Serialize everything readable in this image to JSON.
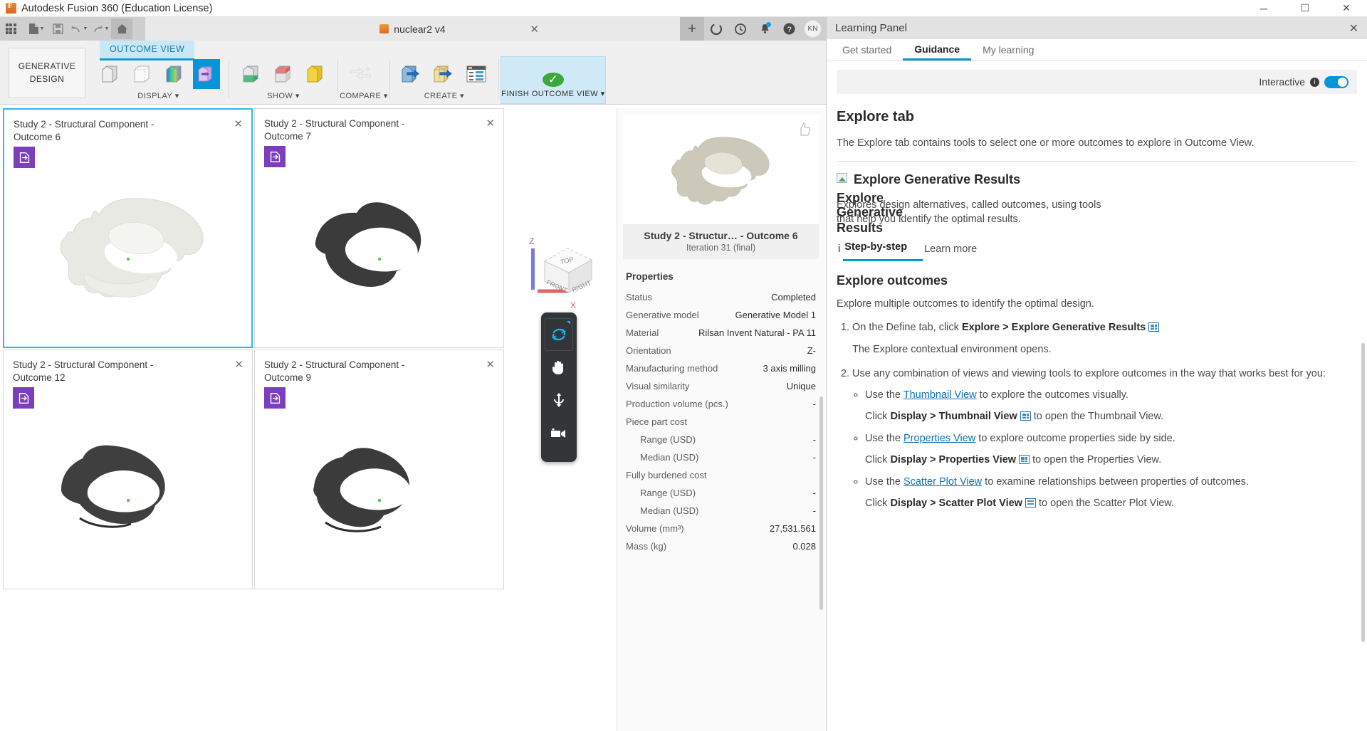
{
  "titlebar": {
    "app_title": "Autodesk Fusion 360 (Education License)",
    "minimize": "─",
    "maximize": "☐",
    "close": "✕"
  },
  "quick_access": {
    "grid_icon": "grid-apps-icon",
    "new_label": "new-document",
    "save_label": "save",
    "undo_label": "undo",
    "redo_label": "redo",
    "home_label": "home",
    "document_tab": "nuclear2 v4",
    "document_close": "✕",
    "add_tab": "+",
    "icons": [
      "job-status-icon",
      "recent-icon",
      "notifications-icon",
      "help-icon"
    ],
    "avatar_initials": "KN"
  },
  "ribbon": {
    "workspace_tab": "OUTCOME VIEW",
    "workspace_button": {
      "line1": "GENERATIVE",
      "line2": "DESIGN"
    },
    "groups": [
      {
        "label": "DISPLAY ▾",
        "items": [
          "shaded-box-icon",
          "wireframe-box-icon",
          "heatmap-box-icon",
          "outcome-view-icon"
        ]
      },
      {
        "label": "SHOW ▾",
        "items": [
          "green-white-box-icon",
          "red-white-box-icon",
          "yellow-box-icon"
        ]
      },
      {
        "label": "COMPARE ▾",
        "items": [
          "compare-arrows-icon"
        ]
      },
      {
        "label": "CREATE ▾",
        "items": [
          "blue-cube-arrow-icon",
          "mesh-cube-arrow-icon",
          "table-list-icon"
        ]
      }
    ],
    "finish": {
      "label": "FINISH OUTCOME VIEW ▾",
      "icon": "green-check-icon"
    }
  },
  "outcomes": [
    {
      "title": "Study 2 - Structural Component - Outcome 6",
      "selected": true,
      "close": "✕",
      "badge": "export-icon",
      "shade": "light"
    },
    {
      "title": "Study 2 - Structural Component - Outcome 7",
      "selected": false,
      "close": "✕",
      "badge": "export-icon",
      "shade": "dark"
    },
    {
      "title": "Study 2 - Structural Component - Outcome 12",
      "selected": false,
      "close": "✕",
      "badge": "export-icon",
      "shade": "dark"
    },
    {
      "title": "Study 2 - Structural Component - Outcome 9",
      "selected": false,
      "close": "✕",
      "badge": "export-icon",
      "shade": "dark"
    }
  ],
  "viewcube": {
    "axis_z": "Z",
    "axis_x": "X",
    "face_top": "TOP",
    "face_front": "FRONT",
    "face_right": "RIGHT"
  },
  "navbar": {
    "items": [
      "orbit-icon",
      "pan-icon",
      "zoom-icon",
      "camera-icon"
    ]
  },
  "properties_panel": {
    "preview": {
      "thumbs_up": "thumbs-up-icon",
      "title": "Study 2 - Structur… - Outcome 6",
      "subtitle": "Iteration 31 (final)"
    },
    "heading": "Properties",
    "rows": [
      {
        "key": "Status",
        "value": "Completed",
        "indent": false
      },
      {
        "key": "Generative model",
        "value": "Generative Model 1",
        "indent": false
      },
      {
        "key": "Material",
        "value": "Rilsan Invent Natural - PA 11",
        "indent": false
      },
      {
        "key": "Orientation",
        "value": "Z-",
        "indent": false
      },
      {
        "key": "Manufacturing method",
        "value": "3 axis milling",
        "indent": false
      },
      {
        "key": "Visual similarity",
        "value": "Unique",
        "indent": false
      },
      {
        "key": "Production volume (pcs.)",
        "value": "-",
        "indent": false
      },
      {
        "key": "Piece part cost",
        "value": "",
        "indent": false
      },
      {
        "key": "Range (USD)",
        "value": "-",
        "indent": true
      },
      {
        "key": "Median (USD)",
        "value": "-",
        "indent": true
      },
      {
        "key": "Fully burdened cost",
        "value": "",
        "indent": false
      },
      {
        "key": "Range (USD)",
        "value": "-",
        "indent": true
      },
      {
        "key": "Median (USD)",
        "value": "-",
        "indent": true
      },
      {
        "key": "Volume (mm³)",
        "value": "27,531.561",
        "indent": false
      },
      {
        "key": "Mass (kg)",
        "value": "0.028",
        "indent": false
      }
    ]
  },
  "learning_panel": {
    "title": "Learning Panel",
    "close": "✕",
    "tabs": [
      {
        "label": "Get started",
        "active": false
      },
      {
        "label": "Guidance",
        "active": true
      },
      {
        "label": "My learning",
        "active": false
      }
    ],
    "interactive_label": "Interactive",
    "interactive_on": true,
    "h1": "Explore tab",
    "p1": "The Explore tab contains tools to select one or more outcomes to explore in Outcome View.",
    "overlay": {
      "title_a": "Explore Generative Results",
      "title_b": "Explore",
      "title_c": "Explores design alternatives, called outcomes, using tools that help you identify the optimal results.",
      "title_d": "Generative",
      "title_e": "Results"
    },
    "subtabs": [
      {
        "label": "Step-by-step",
        "active": true
      },
      {
        "label": "Learn more",
        "active": false
      }
    ],
    "h2": "Explore outcomes",
    "p2": "Explore multiple outcomes to identify the optimal design.",
    "steps": [
      {
        "pre": "On the Define tab, click ",
        "bold": "Explore > Explore Generative Results",
        "post": "",
        "icon": "grid-view-icon",
        "note": "The Explore contextual environment opens.",
        "subitems": []
      },
      {
        "pre": "Use any combination of views and viewing tools to explore outcomes in the way that works best for you:",
        "bold": "",
        "post": "",
        "icon": "",
        "note": "",
        "subitems": [
          {
            "pre": "Use the ",
            "link": "Thumbnail View",
            "post": " to explore the outcomes visually.",
            "click_pre": "Click ",
            "click_bold": "Display > Thumbnail View",
            "click_icon": "grid-view-icon",
            "click_post": " to open the Thumbnail View."
          },
          {
            "pre": "Use the ",
            "link": "Properties View",
            "post": " to explore outcome properties side by side.",
            "click_pre": "Click ",
            "click_bold": "Display > Properties View",
            "click_icon": "grid-view-icon",
            "click_post": " to open the Properties View."
          },
          {
            "pre": "Use the ",
            "link": "Scatter Plot View",
            "post": " to examine relationships between properties of outcomes.",
            "click_pre": "Click ",
            "click_bold": "Display > Scatter Plot View",
            "click_icon": "list-view-icon",
            "click_post": " to open the Scatter Plot View."
          }
        ]
      }
    ]
  },
  "colors": {
    "accent": "#0696d7",
    "select_border": "#3cb4e8",
    "badge_purple": "#7b3fbe",
    "check_green": "#3aa93a",
    "tab_bg": "#c9e8f7",
    "link": "#0a71b5"
  }
}
